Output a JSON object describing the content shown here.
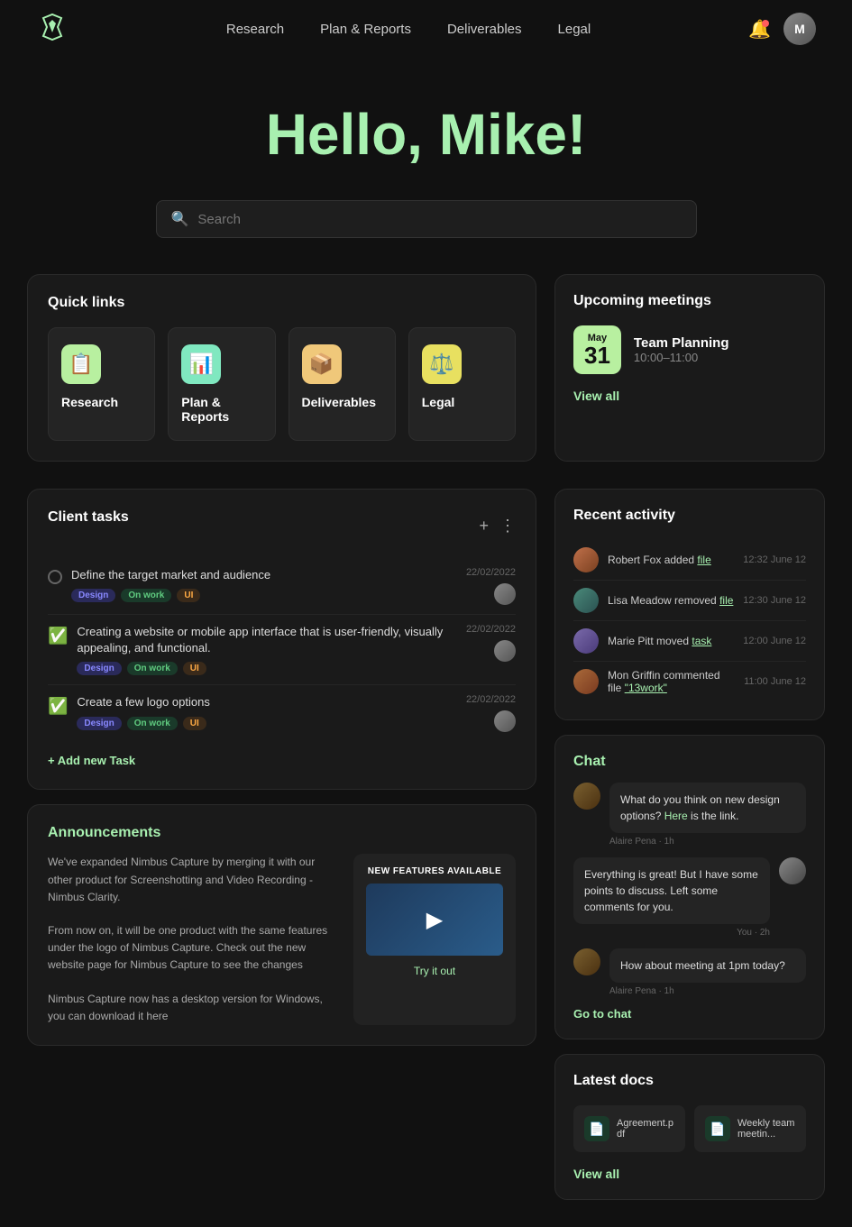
{
  "nav": {
    "links": [
      {
        "label": "Research",
        "id": "research"
      },
      {
        "label": "Plan & Reports",
        "id": "plan-reports"
      },
      {
        "label": "Deliverables",
        "id": "deliverables"
      },
      {
        "label": "Legal",
        "id": "legal"
      }
    ]
  },
  "hero": {
    "greeting": "Hello, ",
    "name": "Mike!",
    "search_placeholder": "Search"
  },
  "quick_links": {
    "title": "Quick links",
    "items": [
      {
        "label": "Research",
        "icon": "📋",
        "color": "green"
      },
      {
        "label": "Plan & Reports",
        "icon": "📊",
        "color": "teal"
      },
      {
        "label": "Deliverables",
        "icon": "📦",
        "color": "orange"
      },
      {
        "label": "Legal",
        "icon": "⚖️",
        "color": "yellow"
      }
    ]
  },
  "upcoming_meetings": {
    "title": "Upcoming meetings",
    "meeting": {
      "month": "May",
      "day": "31",
      "name": "Team Planning",
      "time": "10:00–11:00"
    },
    "view_all": "View all"
  },
  "client_tasks": {
    "title": "Client tasks",
    "tasks": [
      {
        "done": false,
        "title": "Define the target market and audience",
        "tags": [
          "Design",
          "On work",
          "UI"
        ],
        "date": "22/02/2022"
      },
      {
        "done": true,
        "title": "Creating a website or mobile app interface that is user-friendly, visually appealing, and functional.",
        "tags": [
          "Design",
          "On work",
          "UI"
        ],
        "date": "22/02/2022"
      },
      {
        "done": true,
        "title": "Create a few logo options",
        "tags": [
          "Design",
          "On work",
          "UI"
        ],
        "date": "22/02/2022"
      }
    ],
    "add_label": "+ Add new Task"
  },
  "announcements": {
    "title": "Announcements",
    "text1": "We've expanded Nimbus Capture by merging it with our other product for Screenshotting and Video Recording - Nimbus Clarity.",
    "text2": "From now on, it will be one product with the same features under the logo of Nimbus Capture. Check out the new website page for Nimbus Capture to see the changes",
    "text3": "Nimbus Capture now has a desktop version for Windows, you can download it here",
    "promo_title": "NEW FEATURES AVAILABLE",
    "promo_link": "Try it out"
  },
  "recent_activity": {
    "title": "Recent activity",
    "items": [
      {
        "user": "Robert Fox",
        "action": "added",
        "item": "file",
        "time": "12:32 June 12"
      },
      {
        "user": "Lisa Meadow",
        "action": "removed",
        "item": "file",
        "time": "12:30 June 12"
      },
      {
        "user": "Marie Pitt",
        "action": "moved",
        "item": "task",
        "time": "12:00 June 12"
      },
      {
        "user": "Mon Griffin",
        "action": "commented file",
        "item": "\"13work\"",
        "time": "11:00 June 12"
      }
    ]
  },
  "chat": {
    "title": "Chat",
    "messages": [
      {
        "sender": "Alaire Pena",
        "time": "1h",
        "side": "left",
        "text": "What do you think on new design options? Here is the link.",
        "link_text": "Here"
      },
      {
        "sender": "You",
        "time": "2h",
        "side": "right",
        "text": "Everything is great! But I have some points to discuss. Left some comments for you."
      },
      {
        "sender": "Alaire Pena",
        "time": "1h",
        "side": "left",
        "text": "How about meeting at 1pm today?"
      }
    ],
    "go_to_chat": "Go to chat"
  },
  "latest_docs": {
    "title": "Latest docs",
    "docs": [
      {
        "name": "Agreement.pdf",
        "icon": "📄"
      },
      {
        "name": "Weekly team meetin...",
        "icon": "📄"
      }
    ],
    "view_all": "View all"
  }
}
